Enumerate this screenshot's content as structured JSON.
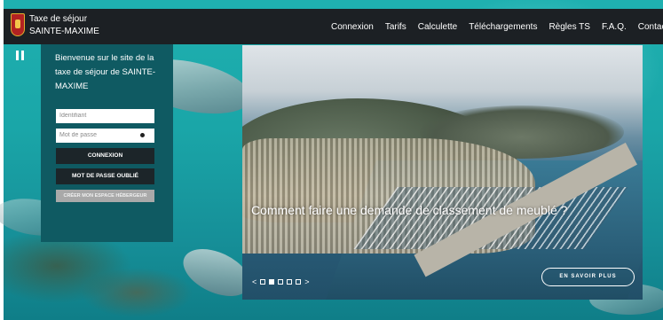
{
  "header": {
    "title_line1": "Taxe de séjour",
    "title_line2": "SAINTE-MAXIME",
    "nav": [
      "Connexion",
      "Tarifs",
      "Calculette",
      "Téléchargements",
      "Règles TS",
      "F.A.Q.",
      "Contact"
    ]
  },
  "login": {
    "welcome": "Bienvenue sur le site de la taxe de séjour de SAINTE-MAXIME",
    "identifier_placeholder": "Identifiant",
    "password_placeholder": "Mot de passe",
    "connect_label": "CONNEXION",
    "forgot_label": "MOT DE PASSE OUBLIÉ",
    "create_label": "CRÉER MON ESPACE HÉBERGEUR"
  },
  "slider": {
    "caption": "Comment faire une demande de classement de meublé ?",
    "prev": "<",
    "next": ">",
    "slide_count": 5,
    "active_slide": 2,
    "more_label": "EN SAVOIR PLUS"
  }
}
